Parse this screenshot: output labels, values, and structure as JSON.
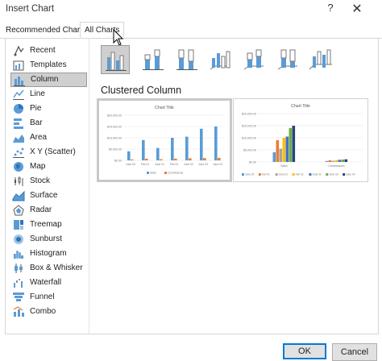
{
  "window": {
    "title": "Insert Chart",
    "help_label": "?",
    "close_label": "✕"
  },
  "tabs": [
    {
      "label": "Recommended Charts",
      "active": false
    },
    {
      "label": "All Charts",
      "active": true
    }
  ],
  "categories": [
    {
      "label": "Recent",
      "icon": "recent-icon"
    },
    {
      "label": "Templates",
      "icon": "templates-icon"
    },
    {
      "label": "Column",
      "icon": "column-chart-icon",
      "selected": true
    },
    {
      "label": "Line",
      "icon": "line-chart-icon"
    },
    {
      "label": "Pie",
      "icon": "pie-chart-icon"
    },
    {
      "label": "Bar",
      "icon": "bar-chart-icon"
    },
    {
      "label": "Area",
      "icon": "area-chart-icon"
    },
    {
      "label": "X Y (Scatter)",
      "icon": "scatter-chart-icon"
    },
    {
      "label": "Map",
      "icon": "map-chart-icon"
    },
    {
      "label": "Stock",
      "icon": "stock-chart-icon"
    },
    {
      "label": "Surface",
      "icon": "surface-chart-icon"
    },
    {
      "label": "Radar",
      "icon": "radar-chart-icon"
    },
    {
      "label": "Treemap",
      "icon": "treemap-chart-icon"
    },
    {
      "label": "Sunburst",
      "icon": "sunburst-chart-icon"
    },
    {
      "label": "Histogram",
      "icon": "histogram-chart-icon"
    },
    {
      "label": "Box & Whisker",
      "icon": "box-whisker-chart-icon"
    },
    {
      "label": "Waterfall",
      "icon": "waterfall-chart-icon"
    },
    {
      "label": "Funnel",
      "icon": "funnel-chart-icon"
    },
    {
      "label": "Combo",
      "icon": "combo-chart-icon"
    }
  ],
  "subtypes": [
    {
      "icon": "clustered-column-icon",
      "selected": true
    },
    {
      "icon": "stacked-column-icon"
    },
    {
      "icon": "100-stacked-column-icon"
    },
    {
      "icon": "3d-clustered-column-icon"
    },
    {
      "icon": "3d-stacked-column-icon"
    },
    {
      "icon": "3d-100-stacked-column-icon"
    },
    {
      "icon": "3d-column-icon"
    }
  ],
  "section_title": "Clustered Column",
  "colors": {
    "blue": "#5b9bd5",
    "orange": "#ed7d31",
    "gray": "#a5a5a5",
    "gold": "#ffc000",
    "darkblue": "#4472c4",
    "green": "#70ad47"
  },
  "chart_data": [
    {
      "type": "bar",
      "title": "Chart Title",
      "categories": [
        "June 00",
        "Feb 01",
        "June 01",
        "Feb 02",
        "June 02",
        "June 03",
        "June 04"
      ],
      "series": [
        {
          "name": "Sales",
          "values": [
            4000,
            9000,
            5500,
            10000,
            10500,
            14000,
            15000
          ]
        },
        {
          "name": "Commissions",
          "values": [
            400,
            700,
            500,
            750,
            900,
            1000,
            1100
          ]
        }
      ],
      "ytick_labels": [
        "$20,000.00",
        "$15,000.00",
        "$10,000.00",
        "$5,000.00",
        "$0.00"
      ],
      "ylim": [
        0,
        20000
      ]
    },
    {
      "type": "bar",
      "title": "Chart Title",
      "categories": [
        "Sales",
        "Commissions"
      ],
      "series": [
        {
          "name": "June 00",
          "values": [
            4000,
            400
          ]
        },
        {
          "name": "Feb 01",
          "values": [
            9000,
            700
          ]
        },
        {
          "name": "June 01",
          "values": [
            5500,
            500
          ]
        },
        {
          "name": "Feb 02",
          "values": [
            10000,
            750
          ]
        },
        {
          "name": "June 02",
          "values": [
            10500,
            900
          ]
        },
        {
          "name": "June 03",
          "values": [
            14000,
            1000
          ]
        },
        {
          "name": "June 04",
          "values": [
            15000,
            1100
          ]
        }
      ],
      "ytick_labels": [
        "$20,000.00",
        "$15,000.00",
        "$10,000.00",
        "$5,000.00",
        "$0.00"
      ],
      "ylim": [
        0,
        20000
      ]
    }
  ],
  "footer": {
    "ok_label": "OK",
    "cancel_label": "Cancel"
  }
}
